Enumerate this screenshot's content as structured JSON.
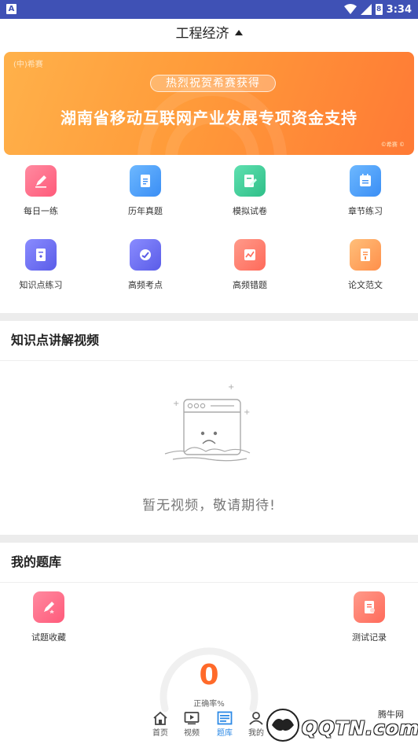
{
  "status_bar": {
    "time": "3:34",
    "app_icon_letter": "A",
    "battery_level": "8"
  },
  "header": {
    "title": "工程经济"
  },
  "banner": {
    "logo": "(中)希赛",
    "tag": "热烈祝贺希赛获得",
    "headline": "湖南省移动互联网产业发展专项资金支持",
    "corner_mark": "©希赛 ©"
  },
  "grid": {
    "items": [
      {
        "label": "每日一练",
        "icon": "pencil-icon",
        "color": "#ff6b88"
      },
      {
        "label": "历年真题",
        "icon": "document-icon",
        "color": "#4da3ff"
      },
      {
        "label": "模拟试卷",
        "icon": "edit-paper-icon",
        "color": "#3ecf9a"
      },
      {
        "label": "章节练习",
        "icon": "checklist-icon",
        "color": "#4da3ff"
      },
      {
        "label": "知识点练习",
        "icon": "bookmark-icon",
        "color": "#6a6cf0"
      },
      {
        "label": "高频考点",
        "icon": "target-icon",
        "color": "#6a6cf0"
      },
      {
        "label": "高频错题",
        "icon": "chart-icon",
        "color": "#ff7a6a"
      },
      {
        "label": "论文范文",
        "icon": "essay-icon",
        "color": "#ff9f5a"
      }
    ]
  },
  "videos": {
    "title": "知识点讲解视频",
    "empty_text": "暂无视频，敬请期待!"
  },
  "mybank": {
    "title": "我的题库",
    "items": [
      {
        "label": "试题收藏",
        "icon": "star-icon",
        "color": "#ff6b88"
      },
      {
        "label": "测试记录",
        "icon": "record-icon",
        "color": "#ff7a6a"
      }
    ],
    "accuracy_value": "0",
    "accuracy_label": "正确率%"
  },
  "tabbar": {
    "tabs": [
      {
        "label": "首页",
        "icon": "home-icon"
      },
      {
        "label": "视频",
        "icon": "video-icon"
      },
      {
        "label": "题库",
        "icon": "question-bank-icon"
      },
      {
        "label": "我的",
        "icon": "user-icon"
      }
    ],
    "active_tab": "题库"
  },
  "watermark": {
    "text": "QQTN.com",
    "cn": "腾牛网"
  }
}
